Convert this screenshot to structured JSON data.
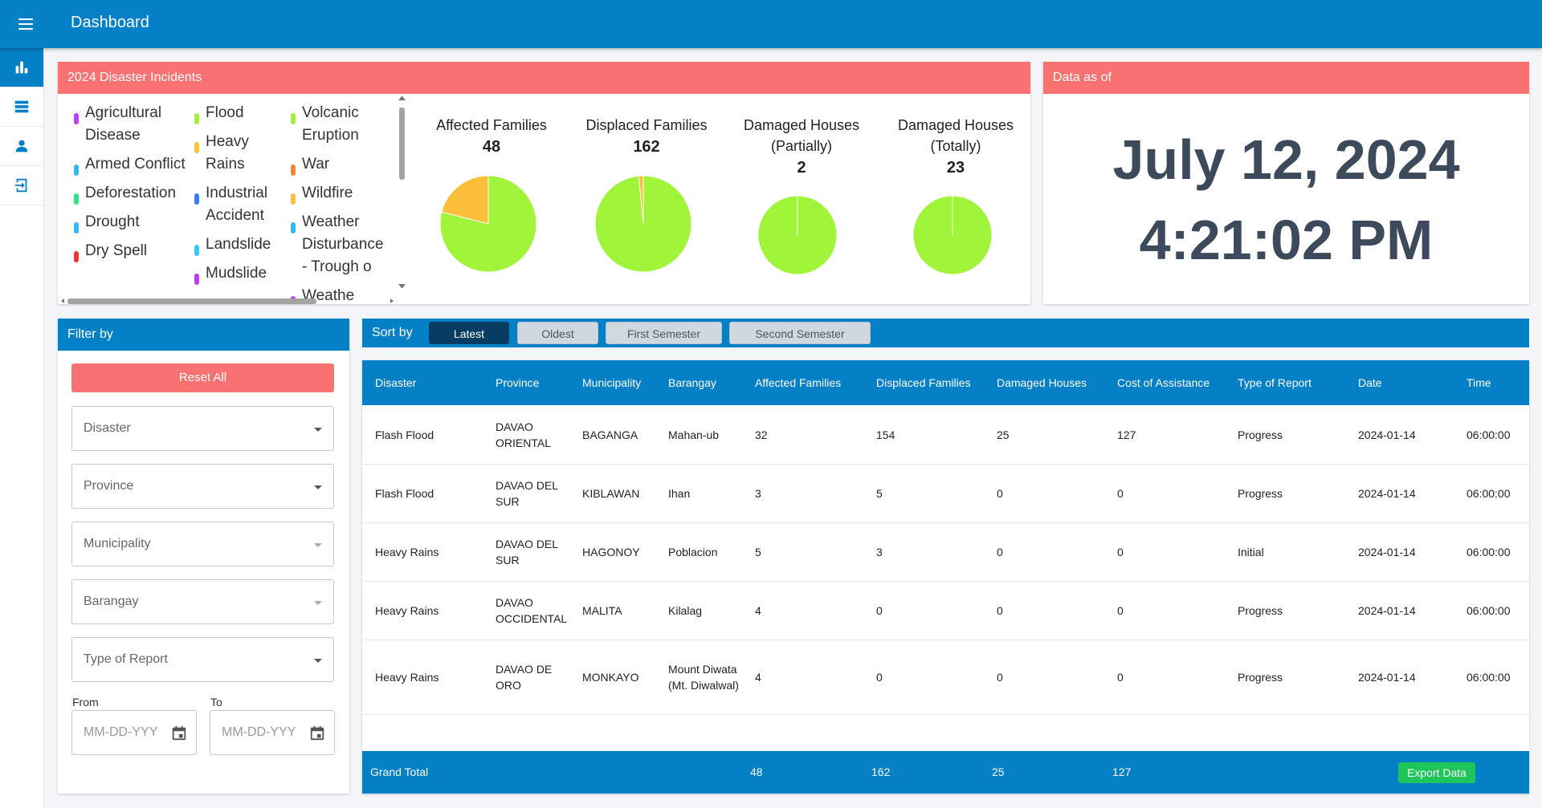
{
  "header": {
    "title": "Dashboard",
    "menu_icon": "hamburger-menu-icon"
  },
  "sidebar": {
    "items": [
      {
        "icon": "bar-chart-icon",
        "active": true
      },
      {
        "icon": "list-icon",
        "active": false
      },
      {
        "icon": "person-icon",
        "active": false
      },
      {
        "icon": "exit-icon",
        "active": false
      }
    ]
  },
  "incidents": {
    "title": "2024 Disaster Incidents",
    "legend_col1": [
      {
        "label": "Agricultural Disease",
        "color": "#c13ff0"
      },
      {
        "label": "Armed Conflict",
        "color": "#35b6f5"
      },
      {
        "label": "Deforestation",
        "color": "#32e38a"
      },
      {
        "label": "Drought",
        "color": "#30b9f2"
      },
      {
        "label": "Dry Spell",
        "color": "#ee3535"
      }
    ],
    "legend_col2": [
      {
        "label": "Flood",
        "color": "#a6f03c"
      },
      {
        "label": "Heavy Rains",
        "color": "#fdc13c"
      },
      {
        "label": "Industrial Accident",
        "color": "#3b7cf2"
      },
      {
        "label": "Landslide",
        "color": "#3cc5f0"
      },
      {
        "label": "Mudslide",
        "color": "#c23af0"
      }
    ],
    "legend_col3": [
      {
        "label": "Volcanic Eruption",
        "color": "#a2f03a"
      },
      {
        "label": "War",
        "color": "#f7852d"
      },
      {
        "label": "Wildfire",
        "color": "#fdc13c"
      },
      {
        "label": "Weather Disturbance - Trough o",
        "color": "#35b6f5"
      },
      {
        "label": "Weathe",
        "color": "#c13ff0"
      }
    ],
    "stats": [
      {
        "label_line1": "Affected Families",
        "label_line2": "",
        "value": "48"
      },
      {
        "label_line1": "Displaced Families",
        "label_line2": "",
        "value": "162"
      },
      {
        "label_line1": "Damaged Houses",
        "label_line2": "(Partially)",
        "value": "2"
      },
      {
        "label_line1": "Damaged Houses",
        "label_line2": "(Totally)",
        "value": "23"
      }
    ],
    "pie_colors": {
      "main": "#a0f53a",
      "secondary": "#fdbf3a"
    },
    "pie_shares": [
      0.79,
      0.985,
      1.0,
      1.0
    ]
  },
  "data_as_of": {
    "title": "Data as of",
    "date": "July 12, 2024",
    "time": "4:21:02 PM"
  },
  "filter": {
    "title": "Filter by",
    "reset_label": "Reset All",
    "disaster": "Disaster",
    "province": "Province",
    "municipality": "Municipality",
    "barangay": "Barangay",
    "type_of_report": "Type of Report",
    "from_label": "From",
    "to_label": "To",
    "from_placeholder": "MM-DD-YYY",
    "to_placeholder": "MM-DD-YYY"
  },
  "sort": {
    "label": "Sort by",
    "options": [
      "Latest",
      "Oldest",
      "First Semester",
      "Second Semester"
    ],
    "active": "Latest"
  },
  "table": {
    "headers": [
      "Disaster",
      "Province",
      "Municipality",
      "Barangay",
      "Affected Families",
      "Displaced Families",
      "Damaged Houses",
      "Cost of Assistance",
      "Type of Report",
      "Date",
      "Time"
    ],
    "rows": [
      {
        "disaster": "Flash Flood",
        "province": "DAVAO ORIENTAL",
        "municipality": "BAGANGA",
        "barangay": "Mahan-ub",
        "affected": "32",
        "displaced": "154",
        "damaged": "25",
        "cost": "127",
        "type": "Progress",
        "date": "2024-01-14",
        "time": "06:00:00"
      },
      {
        "disaster": "Flash Flood",
        "province": "DAVAO DEL SUR",
        "municipality": "KIBLAWAN",
        "barangay": "Ihan",
        "affected": "3",
        "displaced": "5",
        "damaged": "0",
        "cost": "0",
        "type": "Progress",
        "date": "2024-01-14",
        "time": "06:00:00"
      },
      {
        "disaster": "Heavy Rains",
        "province": "DAVAO DEL SUR",
        "municipality": "HAGONOY",
        "barangay": "Poblacion",
        "affected": "5",
        "displaced": "3",
        "damaged": "0",
        "cost": "0",
        "type": "Initial",
        "date": "2024-01-14",
        "time": "06:00:00"
      },
      {
        "disaster": "Heavy Rains",
        "province": "DAVAO OCCIDENTAL",
        "municipality": "MALITA",
        "barangay": "Kilalag",
        "affected": "4",
        "displaced": "0",
        "damaged": "0",
        "cost": "0",
        "type": "Progress",
        "date": "2024-01-14",
        "time": "06:00:00"
      },
      {
        "disaster": "Heavy Rains",
        "province": "DAVAO DE ORO",
        "municipality": "MONKAYO",
        "barangay": "Mount Diwata (Mt. Diwalwal)",
        "affected": "4",
        "displaced": "0",
        "damaged": "0",
        "cost": "0",
        "type": "Progress",
        "date": "2024-01-14",
        "time": "06:00:00"
      }
    ],
    "grand_total": {
      "label": "Grand Total",
      "affected": "48",
      "displaced": "162",
      "damaged": "25",
      "cost": "127"
    },
    "export_label": "Export Data"
  }
}
